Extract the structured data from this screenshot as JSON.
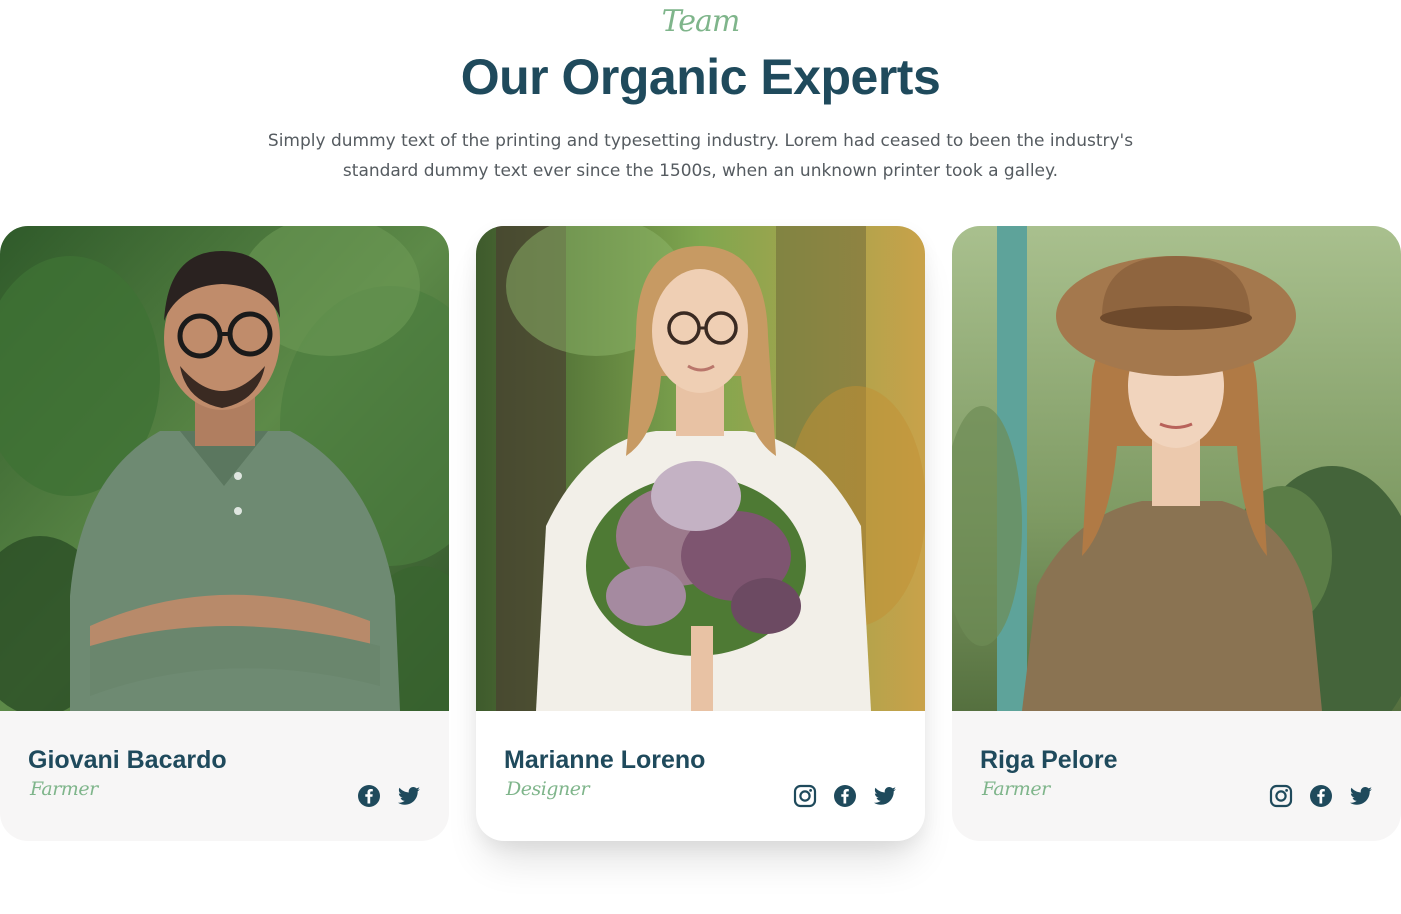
{
  "section": {
    "eyebrow": "Team",
    "title": "Our Organic Experts",
    "intro": "Simply dummy text of the printing and typesetting industry. Lorem had ceased to been the industry's standard dummy text ever since the 1500s, when an unknown printer took a galley."
  },
  "team": [
    {
      "name": "Giovani Bacardo",
      "role": "Farmer",
      "photo": "portrait-man-green-polo-glasses",
      "socials": [
        "facebook-icon",
        "twitter-icon"
      ]
    },
    {
      "name": "Marianne Loreno",
      "role": "Designer",
      "photo": "portrait-woman-holding-lilac-bouquet",
      "socials": [
        "instagram-icon",
        "facebook-icon",
        "twitter-icon"
      ]
    },
    {
      "name": "Riga Pelore",
      "role": "Farmer",
      "photo": "portrait-woman-brown-hat-sweater",
      "socials": [
        "instagram-icon",
        "facebook-icon",
        "twitter-icon"
      ]
    }
  ],
  "colors": {
    "accent_green": "#7fb58b",
    "heading_navy": "#1f4a5c",
    "card_bg": "#f7f6f6",
    "body_text": "#555b60"
  }
}
